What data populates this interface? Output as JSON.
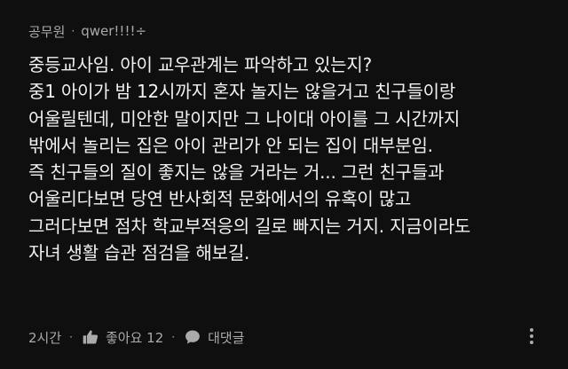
{
  "comment": {
    "author": "공무원",
    "separator": "·",
    "handle": "qwer!!!!÷",
    "lines": [
      "중등교사임. 아이 교우관계는 파악하고 있는지?",
      "중1 아이가 밤 12시까지 혼자 놀지는 않을거고 친구들이랑",
      "어울릴텐데, 미안한 말이지만 그 나이대 아이를 그 시간까지",
      "밖에서 놀리는 집은 아이 관리가 안 되는 집이 대부분임.",
      "즉 친구들의 질이 좋지는 않을 거라는 거... 그런 친구들과",
      "어울리다보면 당연 반사회적 문화에서의 유혹이 많고",
      "그러다보면 점차 학교부적응의 길로 빠지는 거지. 지금이라도",
      "자녀 생활 습관 점검을 해보길."
    ],
    "actions": {
      "time": "2시간",
      "separator": "·",
      "like_label": "좋아요 12",
      "reply_label": "대댓글"
    },
    "icons": {
      "like": "thumbs-up-icon",
      "reply": "speech-bubble-icon",
      "more": "more-vertical-icon"
    },
    "colors": {
      "background": "#0f0f0f",
      "text": "#f1f1f1",
      "muted": "#aaaaaa"
    }
  }
}
